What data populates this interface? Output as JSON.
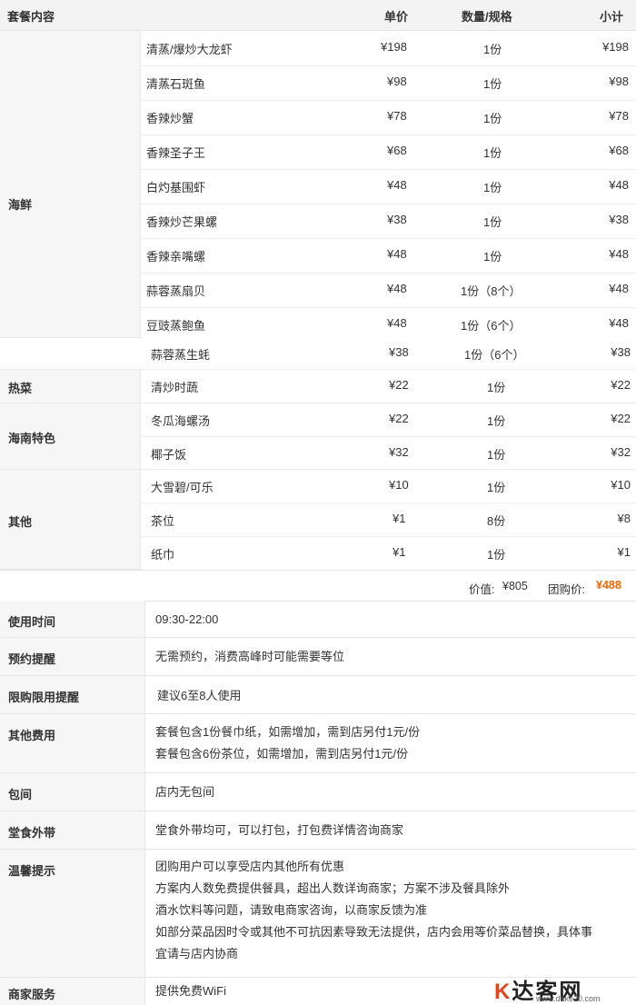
{
  "header": {
    "col_content": "套餐内容",
    "col_price": "单价",
    "col_qty": "数量/规格",
    "col_subtotal": "小计"
  },
  "groups": [
    {
      "label": "海鲜"
    },
    {
      "label": "热菜"
    },
    {
      "label": "海南特色"
    },
    {
      "label": "其他"
    }
  ],
  "items": [
    {
      "name": "清蒸/爆炒大龙虾",
      "price": "¥198",
      "qty": "1份",
      "subtotal": "¥198"
    },
    {
      "name": "清蒸石斑鱼",
      "price": "¥98",
      "qty": "1份",
      "subtotal": "¥98"
    },
    {
      "name": "香辣炒蟹",
      "price": "¥78",
      "qty": "1份",
      "subtotal": "¥78"
    },
    {
      "name": "香辣圣子王",
      "price": "¥68",
      "qty": "1份",
      "subtotal": "¥68"
    },
    {
      "name": "白灼基围虾",
      "price": "¥48",
      "qty": "1份",
      "subtotal": "¥48"
    },
    {
      "name": "香辣炒芒果螺",
      "price": "¥38",
      "qty": "1份",
      "subtotal": "¥38"
    },
    {
      "name": "香辣亲嘴螺",
      "price": "¥48",
      "qty": "1份",
      "subtotal": "¥48"
    },
    {
      "name": "蒜蓉蒸扇贝",
      "price": "¥48",
      "qty": "1份（8个）",
      "subtotal": "¥48"
    },
    {
      "name": "豆豉蒸鲍鱼",
      "price": "¥48",
      "qty": "1份（6个）",
      "subtotal": "¥48"
    },
    {
      "name": "蒜蓉蒸生蚝",
      "price": "¥38",
      "qty": "1份（6个）",
      "subtotal": "¥38"
    },
    {
      "name": "清炒时蔬",
      "price": "¥22",
      "qty": "1份",
      "subtotal": "¥22"
    },
    {
      "name": "冬瓜海螺汤",
      "price": "¥22",
      "qty": "1份",
      "subtotal": "¥22"
    },
    {
      "name": "椰子饭",
      "price": "¥32",
      "qty": "1份",
      "subtotal": "¥32"
    },
    {
      "name": "大雪碧/可乐",
      "price": "¥10",
      "qty": "1份",
      "subtotal": "¥10"
    },
    {
      "name": "茶位",
      "price": "¥1",
      "qty": "8份",
      "subtotal": "¥8"
    },
    {
      "name": "纸巾",
      "price": "¥1",
      "qty": "1份",
      "subtotal": "¥1"
    }
  ],
  "summary": {
    "value_label": "价值:",
    "value": "¥805",
    "group_label": "团购价:",
    "group_price": "¥488"
  },
  "info": [
    {
      "label": "使用时间",
      "lines": [
        "09:30-22:00"
      ]
    },
    {
      "label": "预约提醒",
      "lines": [
        "无需预约，消费高峰时可能需要等位"
      ]
    },
    {
      "label": "限购限用提醒",
      "lines": [
        "建议6至8人使用"
      ]
    },
    {
      "label": "其他费用",
      "lines": [
        "套餐包含1份餐巾纸，如需增加，需到店另付1元/份",
        "套餐包含6份茶位，如需增加，需到店另付1元/份"
      ]
    },
    {
      "label": "包间",
      "lines": [
        "店内无包间"
      ]
    },
    {
      "label": "堂食外带",
      "lines": [
        "堂食外带均可，可以打包，打包费详情咨询商家"
      ]
    },
    {
      "label": "温馨提示",
      "lines": [
        "团购用户可以享受店内其他所有优惠",
        "方案内人数免费提供餐具，超出人数详询商家；方案不涉及餐具除外",
        "酒水饮料等问题，请致电商家咨询，以商家反馈为准",
        "如部分菜品因时令或其他不可抗因素导致无法提供，店内会用等价菜品替换，具体事",
        "宜请与店内协商"
      ]
    },
    {
      "label": "商家服务",
      "lines": [
        "提供免费WiFi"
      ]
    }
  ],
  "watermark": {
    "site": "达客网",
    "url": "www.dake20.com"
  }
}
